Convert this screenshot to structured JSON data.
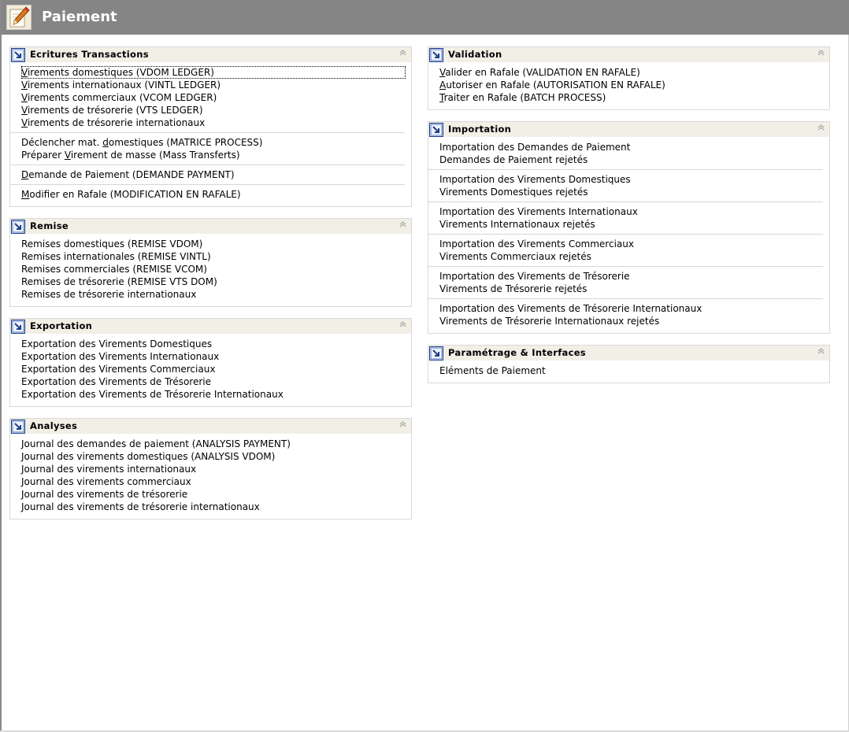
{
  "header": {
    "title": "Paiement"
  },
  "left_panels": [
    {
      "title": "Ecritures Transactions",
      "groups": [
        [
          {
            "acc": "V",
            "rest": "irements domestiques (VDOM LEDGER)"
          },
          {
            "acc": "V",
            "rest": "irements internationaux (VINTL LEDGER)"
          },
          {
            "acc": "V",
            "rest": "irements commerciaux (VCOM LEDGER)"
          },
          {
            "acc": "V",
            "rest": "irements de trésorerie (VTS LEDGER)"
          },
          {
            "acc": "V",
            "rest": "irements de trésorerie internationaux"
          }
        ],
        [
          {
            "pre": "Déclencher mat. ",
            "acc": "d",
            "rest": "omestiques (MATRICE PROCESS)"
          },
          {
            "pre": "Préparer ",
            "acc": "V",
            "rest": "irement de masse (Mass Transferts)"
          }
        ],
        [
          {
            "acc": "D",
            "rest": "emande de Paiement (DEMANDE PAYMENT)"
          }
        ],
        [
          {
            "acc": "M",
            "rest": "odifier en Rafale (MODIFICATION EN RAFALE)"
          }
        ]
      ]
    },
    {
      "title": "Remise",
      "groups": [
        [
          {
            "rest": "Remises domestiques  (REMISE VDOM)"
          },
          {
            "rest": "Remises internationales (REMISE VINTL)"
          },
          {
            "rest": "Remises commerciales (REMISE VCOM)"
          },
          {
            "rest": "Remises de trésorerie  (REMISE VTS DOM)"
          },
          {
            "rest": "Remises de trésorerie internationaux"
          }
        ]
      ]
    },
    {
      "title": "Exportation",
      "groups": [
        [
          {
            "rest": "Exportation des Virements Domestiques"
          },
          {
            "rest": "Exportation des Virements Internationaux"
          },
          {
            "rest": "Exportation des Virements Commerciaux"
          },
          {
            "rest": "Exportation des Virements de Trésorerie"
          },
          {
            "rest": "Exportation des Virements de Trésorerie Internationaux"
          }
        ]
      ]
    },
    {
      "title": "Analyses",
      "groups": [
        [
          {
            "rest": "Journal des demandes de paiement (ANALYSIS PAYMENT)"
          },
          {
            "rest": "Journal des virements domestiques (ANALYSIS VDOM)"
          },
          {
            "rest": "Journal des virements internationaux"
          },
          {
            "rest": "Journal des virements commerciaux"
          },
          {
            "rest": "Journal des virements de trésorerie"
          },
          {
            "rest": "Journal des virements de trésorerie internationaux"
          }
        ]
      ]
    }
  ],
  "right_panels": [
    {
      "title": "Validation",
      "groups": [
        [
          {
            "acc": "V",
            "rest": "alider en Rafale (VALIDATION EN RAFALE)"
          },
          {
            "acc": "A",
            "rest": "utoriser en Rafale (AUTORISATION EN RAFALE)"
          },
          {
            "acc": "T",
            "rest": "raiter en Rafale (BATCH PROCESS)"
          }
        ]
      ]
    },
    {
      "title": "Importation",
      "groups": [
        [
          {
            "rest": "Importation des Demandes de Paiement"
          },
          {
            "rest": "Demandes de Paiement rejetés"
          }
        ],
        [
          {
            "rest": "Importation des Virements Domestiques"
          },
          {
            "rest": "Virements Domestiques rejetés"
          }
        ],
        [
          {
            "rest": "Importation des Virements Internationaux"
          },
          {
            "rest": "Virements Internationaux rejetés"
          }
        ],
        [
          {
            "rest": "Importation des Virements Commerciaux"
          },
          {
            "rest": "Virements Commerciaux rejetés"
          }
        ],
        [
          {
            "rest": "Importation des Virements de Trésorerie"
          },
          {
            "rest": "Virements de Trésorerie  rejetés"
          }
        ],
        [
          {
            "rest": "Importation des Virements de Trésorerie Internationaux"
          },
          {
            "rest": "Virements de Trésorerie Internationaux rejetés"
          }
        ]
      ]
    },
    {
      "title": "Paramétrage & Interfaces",
      "groups": [
        [
          {
            "rest": "Eléments de Paiement"
          }
        ]
      ]
    }
  ],
  "icons": {
    "header_logo": "pencil-paper-icon",
    "panel_icon": "shortcut-arrow-icon",
    "collapse": "double-chevron-up-icon"
  },
  "colors": {
    "header_bg": "#858585",
    "panel_header_bg": "#f1efe6",
    "panel_border": "#d9d9d9"
  }
}
